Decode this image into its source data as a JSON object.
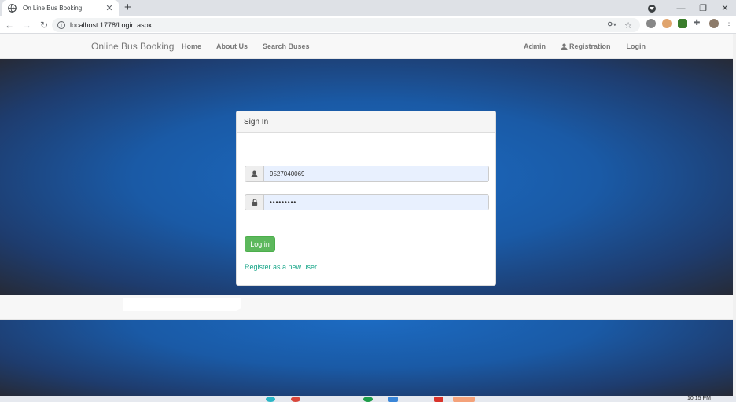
{
  "browser": {
    "tab_title": "On Line Bus Booking",
    "tab_close": "✕",
    "new_tab": "+",
    "url": "localhost:1778/Login.aspx",
    "window_controls": {
      "minimize": "—",
      "restore": "❐",
      "close": "✕"
    },
    "nav": {
      "back": "←",
      "forward": "→",
      "reload": "↻"
    },
    "icons": {
      "key": "key-icon",
      "star": "star-icon",
      "puzzle": "puzzle-icon"
    }
  },
  "site": {
    "brand": "Online Bus Booking",
    "nav_left": [
      "Home",
      "About Us",
      "Search Buses"
    ],
    "nav_right": {
      "admin": "Admin",
      "registration": "Registration",
      "login": "Login"
    }
  },
  "signin": {
    "heading": "Sign In",
    "username_value": "9527040069",
    "password_value": "•••••••••",
    "login_button": "Log in",
    "register_link": "Register as a new user"
  },
  "taskbar": {
    "clock": "10:15 PM"
  },
  "colors": {
    "brand_green": "#5cb85c",
    "link_teal": "#18a689",
    "hero_blue": "#1c6bc2"
  }
}
